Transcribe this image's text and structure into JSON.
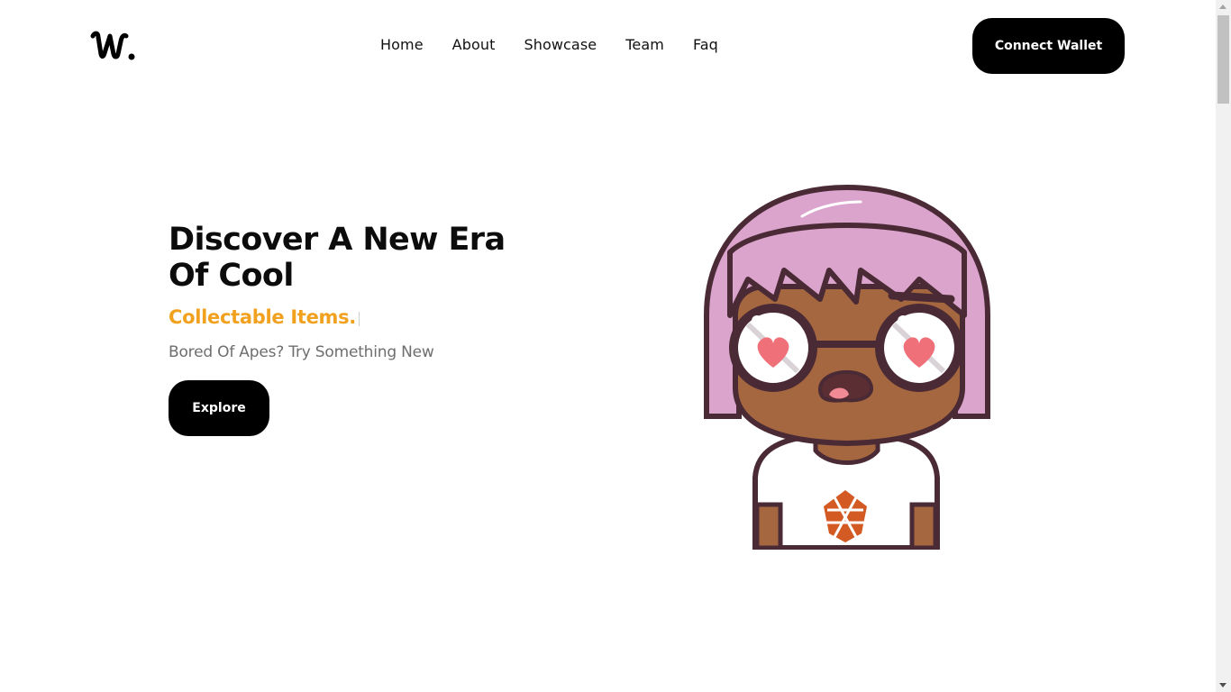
{
  "header": {
    "nav_items": [
      "Home",
      "About",
      "Showcase",
      "Team",
      "Faq"
    ],
    "connect_label": "Connect Wallet"
  },
  "hero": {
    "title": "Discover A New Era Of Cool",
    "subtitle": "Collectable Items.",
    "tagline": "Bored Of Apes? Try Something New",
    "explore_label": "Explore"
  },
  "colors": {
    "accent": "#f2a11f",
    "button_bg": "#000000",
    "text": "#0c0c0c",
    "muted": "#6e6e6e"
  },
  "icons": {
    "logo": "w-script-logo",
    "hero": "nft-character-illustration"
  }
}
